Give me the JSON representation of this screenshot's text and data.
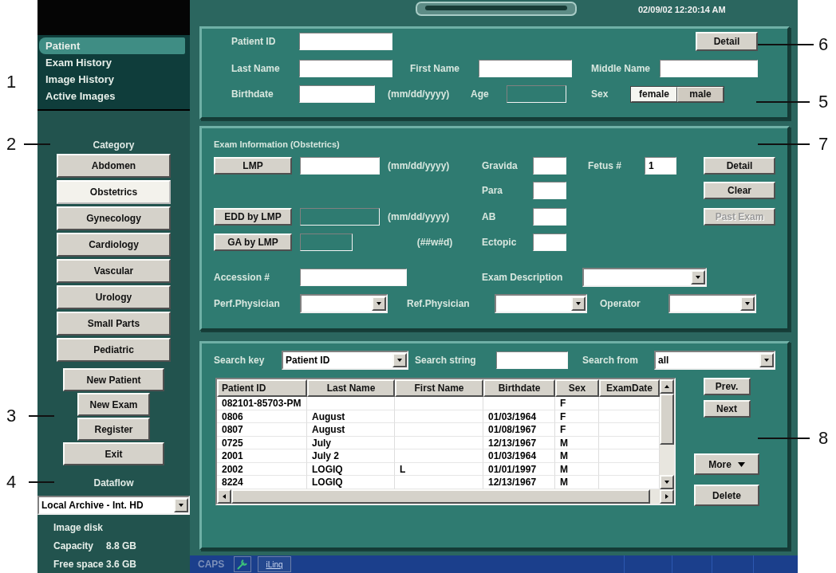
{
  "left_callouts": [
    "1",
    "2",
    "3",
    "4"
  ],
  "right_callouts": [
    "6",
    "5",
    "7",
    "8"
  ],
  "sidebar": {
    "nav": [
      {
        "label": "Patient",
        "selected": true
      },
      {
        "label": "Exam History",
        "selected": false
      },
      {
        "label": "Image History",
        "selected": false
      },
      {
        "label": "Active Images",
        "selected": false
      }
    ],
    "category_label": "Category",
    "categories": [
      {
        "label": "Abdomen",
        "selected": false
      },
      {
        "label": "Obstetrics",
        "selected": true
      },
      {
        "label": "Gynecology",
        "selected": false
      },
      {
        "label": "Cardiology",
        "selected": false
      },
      {
        "label": "Vascular",
        "selected": false
      },
      {
        "label": "Urology",
        "selected": false
      },
      {
        "label": "Small Parts",
        "selected": false
      },
      {
        "label": "Pediatric",
        "selected": false
      }
    ],
    "actions": [
      "New Patient",
      "New Exam",
      "Register",
      "Exit"
    ],
    "dataflow_label": "Dataflow",
    "dataflow": "Local Archive - Int. HD",
    "disk": {
      "title": "Image disk",
      "rows": [
        {
          "label": "Capacity",
          "value": "8.8 GB"
        },
        {
          "label": "Free space",
          "value": "3.6 GB"
        }
      ]
    }
  },
  "datetime": "02/09/02 12:20:14 AM",
  "patient": {
    "patient_id_label": "Patient ID",
    "detail_button": "Detail",
    "last_name_label": "Last Name",
    "first_name_label": "First Name",
    "middle_name_label": "Middle Name",
    "birthdate_label": "Birthdate",
    "date_hint": "(mm/dd/yyyy)",
    "age_label": "Age",
    "sex_label": "Sex",
    "sex_options": [
      {
        "label": "female",
        "selected": true
      },
      {
        "label": "male",
        "selected": false
      }
    ]
  },
  "exam": {
    "title": "Exam Information (Obstetrics)",
    "lmp_button": "LMP",
    "lmp_hint": "(mm/dd/yyyy)",
    "gravida_label": "Gravida",
    "fetus_label": "Fetus #",
    "fetus_value": "1",
    "para_label": "Para",
    "edd_button": "EDD by LMP",
    "edd_hint": "(mm/dd/yyyy)",
    "ab_label": "AB",
    "ga_button": "GA by LMP",
    "ga_hint": "(##w#d)",
    "ectopic_label": "Ectopic",
    "side_buttons": [
      {
        "label": "Detail",
        "disabled": false
      },
      {
        "label": "Clear",
        "disabled": false
      },
      {
        "label": "Past Exam",
        "disabled": true
      }
    ],
    "accession_label": "Accession #",
    "exam_description_label": "Exam Description",
    "perf_physician_label": "Perf.Physician",
    "ref_physician_label": "Ref.Physician",
    "operator_label": "Operator"
  },
  "search": {
    "key_label": "Search key",
    "key_value": "Patient ID",
    "string_label": "Search string",
    "from_label": "Search from",
    "from_value": "all",
    "table": {
      "columns": [
        "Patient ID",
        "Last Name",
        "First Name",
        "Birthdate",
        "Sex",
        "ExamDate"
      ],
      "rows": [
        [
          "082101-85703-PM",
          "",
          "",
          "",
          "F",
          ""
        ],
        [
          "0806",
          "August",
          "",
          "01/03/1964",
          "F",
          ""
        ],
        [
          "0807",
          "August",
          "",
          "01/08/1967",
          "F",
          ""
        ],
        [
          "0725",
          "July",
          "",
          "12/13/1967",
          "M",
          ""
        ],
        [
          "2001",
          "July 2",
          "",
          "01/03/1964",
          "M",
          ""
        ],
        [
          "2002",
          "LOGIQ",
          "L",
          "01/01/1997",
          "M",
          ""
        ],
        [
          "8224",
          "LOGIQ",
          "",
          "12/13/1967",
          "M",
          ""
        ]
      ]
    },
    "prev_button": "Prev.",
    "next_button": "Next",
    "more_button": "More",
    "delete_button": "Delete"
  },
  "status_bar": {
    "caps": "CAPS",
    "iling": "iLinq"
  }
}
